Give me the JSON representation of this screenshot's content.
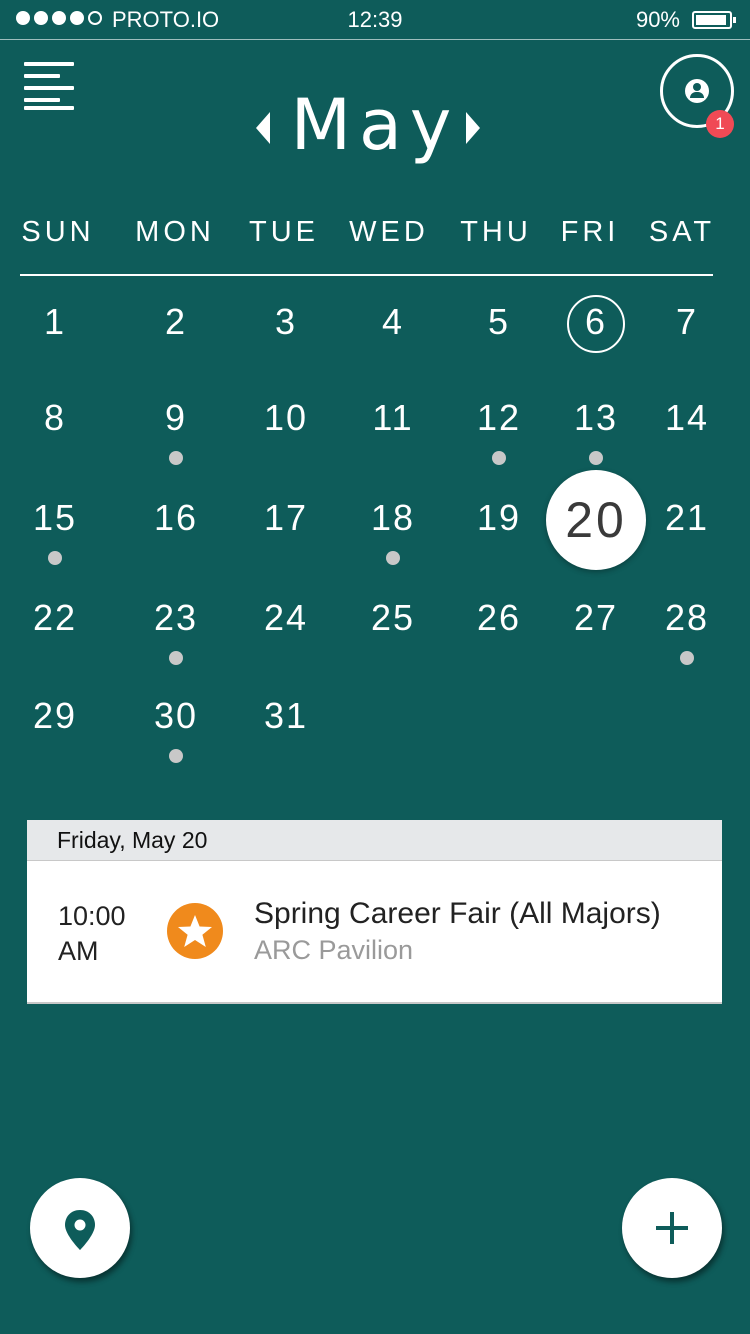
{
  "status_bar": {
    "carrier": "PROTO.IO",
    "time": "12:39",
    "battery_percent": "90%",
    "signal_bars_filled": 4,
    "signal_bars_total": 5
  },
  "header": {
    "month": "May",
    "menu_icon": "hamburger-menu-icon",
    "profile_icon": "user-icon",
    "notification_count": "1"
  },
  "weekdays": [
    "SUN",
    "MON",
    "TUE",
    "WED",
    "THU",
    "FRI",
    "SAT"
  ],
  "calendar": {
    "today": "6",
    "selected": "20",
    "days_with_events": [
      "9",
      "12",
      "13",
      "15",
      "18",
      "23",
      "28",
      "30"
    ]
  },
  "agenda": {
    "date_header": "Friday, May 20",
    "events": [
      {
        "time_line1": "10:00",
        "time_line2": "AM",
        "title": "Spring Career Fair (All Majors)",
        "location": "ARC Pavilion",
        "icon": "star-icon",
        "icon_color": "#f08a1c"
      }
    ]
  },
  "fabs": {
    "location_icon": "location-pin-icon",
    "add_icon": "plus-icon"
  },
  "colors": {
    "background": "#0e5c5a",
    "badge": "#f04a55",
    "event_dot": "#c8c8c8"
  }
}
